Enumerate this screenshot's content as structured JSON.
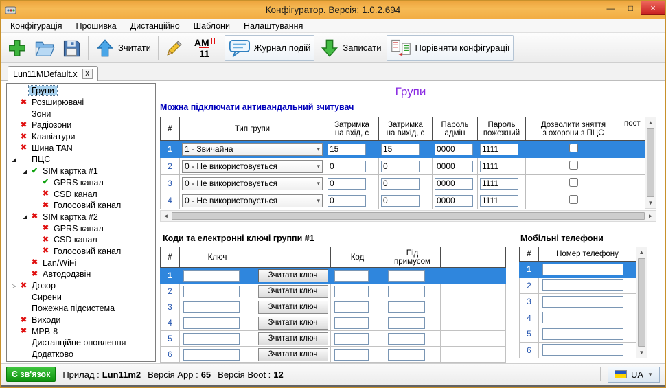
{
  "window": {
    "title": "Конфігуратор. Версія: 1.0.2.694",
    "controls": {
      "minimize": "—",
      "maximize": "□",
      "close": "×"
    }
  },
  "menu": {
    "items": [
      "Конфігурація",
      "Прошивка",
      "Дистанційно",
      "Шаблони",
      "Налаштування"
    ]
  },
  "toolbar": {
    "read_label": "Зчитати",
    "am_text": "AM",
    "am_number": "11",
    "journal_label": "Журнал подій",
    "write_label": "Записати",
    "compare_label": "Порівняти конфігурації",
    "icons": {
      "new": "green-plus",
      "open": "folder-open",
      "save": "floppy-disk",
      "read": "blue-arrow-up",
      "edit": "pencil",
      "am": "am-11-badge",
      "journal": "speech-bubble",
      "write": "green-arrow-down",
      "compare": "compare-documents"
    }
  },
  "tab": {
    "label": "Lun11MDefault.x",
    "close_label": "x"
  },
  "tree": {
    "items": [
      {
        "label": "Групи",
        "level": 0,
        "icon": "none",
        "expander": null,
        "selected": true
      },
      {
        "label": "Розширювачі",
        "level": 0,
        "icon": "cross",
        "expander": null,
        "selected": false
      },
      {
        "label": "Зони",
        "level": 0,
        "icon": "none",
        "expander": null,
        "selected": false
      },
      {
        "label": "Радіозони",
        "level": 0,
        "icon": "cross",
        "expander": null,
        "selected": false
      },
      {
        "label": "Клавіатури",
        "level": 0,
        "icon": "cross",
        "expander": null,
        "selected": false
      },
      {
        "label": "Шина TAN",
        "level": 0,
        "icon": "cross",
        "expander": null,
        "selected": false
      },
      {
        "label": "ПЦС",
        "level": 0,
        "icon": "none",
        "expander": "expanded",
        "selected": false
      },
      {
        "label": "SIM картка #1",
        "level": 1,
        "icon": "check",
        "expander": "expanded",
        "selected": false
      },
      {
        "label": "GPRS канал",
        "level": 2,
        "icon": "check",
        "expander": null,
        "selected": false
      },
      {
        "label": "CSD канал",
        "level": 2,
        "icon": "cross",
        "expander": null,
        "selected": false
      },
      {
        "label": "Голосовий канал",
        "level": 2,
        "icon": "cross",
        "expander": null,
        "selected": false
      },
      {
        "label": "SIM картка #2",
        "level": 1,
        "icon": "cross",
        "expander": "expanded",
        "selected": false
      },
      {
        "label": "GPRS канал",
        "level": 2,
        "icon": "cross",
        "expander": null,
        "selected": false
      },
      {
        "label": "CSD канал",
        "level": 2,
        "icon": "cross",
        "expander": null,
        "selected": false
      },
      {
        "label": "Голосовий канал",
        "level": 2,
        "icon": "cross",
        "expander": null,
        "selected": false
      },
      {
        "label": "Lan/WiFi",
        "level": 1,
        "icon": "cross",
        "expander": null,
        "selected": false
      },
      {
        "label": "Автододзвін",
        "level": 1,
        "icon": "cross",
        "expander": null,
        "selected": false
      },
      {
        "label": "Дозор",
        "level": 0,
        "icon": "cross",
        "expander": "collapsed",
        "selected": false
      },
      {
        "label": "Сирени",
        "level": 0,
        "icon": "none",
        "expander": null,
        "selected": false
      },
      {
        "label": "Пожежна підсистема",
        "level": 0,
        "icon": "none",
        "expander": null,
        "selected": false
      },
      {
        "label": "Виходи",
        "level": 0,
        "icon": "cross",
        "expander": null,
        "selected": false
      },
      {
        "label": "МРВ-8",
        "level": 0,
        "icon": "cross",
        "expander": null,
        "selected": false
      },
      {
        "label": "Дистанційне оновлення",
        "level": 0,
        "icon": "none",
        "expander": null,
        "selected": false
      },
      {
        "label": "Додатково",
        "level": 0,
        "icon": "none",
        "expander": null,
        "selected": false
      }
    ]
  },
  "main": {
    "title": "Групи",
    "note": "Можна підключати антивандальний зчитувач",
    "groups_table": {
      "headers": {
        "num": "#",
        "type": "Тип групи",
        "delay_in": "Затримка\nна вхід, с",
        "delay_out": "Затримка\nна вихід, с",
        "pass_admin": "Пароль\nадмін",
        "pass_fire": "Пароль\nпожежний",
        "allow": "Дозволити зняття\nз охорони з ПЦС",
        "post": "пост"
      },
      "rows": [
        {
          "num": "1",
          "type": "1 - Звичайна",
          "delay_in": "15",
          "delay_out": "15",
          "pass_admin": "0000",
          "pass_fire": "1111",
          "allow_checked": false,
          "selected": true
        },
        {
          "num": "2",
          "type": "0 - Не використовується",
          "delay_in": "0",
          "delay_out": "0",
          "pass_admin": "0000",
          "pass_fire": "1111",
          "allow_checked": false,
          "selected": false
        },
        {
          "num": "3",
          "type": "0 - Не використовується",
          "delay_in": "0",
          "delay_out": "0",
          "pass_admin": "0000",
          "pass_fire": "1111",
          "allow_checked": false,
          "selected": false
        },
        {
          "num": "4",
          "type": "0 - Не використовується",
          "delay_in": "0",
          "delay_out": "0",
          "pass_admin": "0000",
          "pass_fire": "1111",
          "allow_checked": false,
          "selected": false
        }
      ]
    },
    "keys": {
      "title": "Коди та електронні ключі группи #1",
      "headers": {
        "num": "#",
        "key": "Ключ",
        "btn": "",
        "code": "Код",
        "coercion": "Під\nпримусом",
        "filler": ""
      },
      "read_key_label": "Зчитати ключ",
      "rows": [
        {
          "num": "1",
          "key": "",
          "code": "",
          "coercion": "",
          "selected": true
        },
        {
          "num": "2",
          "key": "",
          "code": "",
          "coercion": "",
          "selected": false
        },
        {
          "num": "3",
          "key": "",
          "code": "",
          "coercion": "",
          "selected": false
        },
        {
          "num": "4",
          "key": "",
          "code": "",
          "coercion": "",
          "selected": false
        },
        {
          "num": "5",
          "key": "",
          "code": "",
          "coercion": "",
          "selected": false
        },
        {
          "num": "6",
          "key": "",
          "code": "",
          "coercion": "",
          "selected": false
        }
      ]
    },
    "phones": {
      "title": "Мобільні телефони",
      "headers": {
        "num": "#",
        "phone": "Номер телефону"
      },
      "rows": [
        {
          "num": "1",
          "phone": "",
          "selected": true
        },
        {
          "num": "2",
          "phone": "",
          "selected": false
        },
        {
          "num": "3",
          "phone": "",
          "selected": false
        },
        {
          "num": "4",
          "phone": "",
          "selected": false
        },
        {
          "num": "5",
          "phone": "",
          "selected": false
        },
        {
          "num": "6",
          "phone": "",
          "selected": false
        }
      ]
    }
  },
  "statusbar": {
    "connection": "Є зв'язок",
    "device_label": "Прилад :",
    "device_value": "Lun11m2",
    "app_label": "Версія App :",
    "app_value": "65",
    "boot_label": "Версія Boot :",
    "boot_value": "12",
    "language": "UA"
  },
  "colors": {
    "titlebar": "#f2ad43",
    "selection_blue": "#2f86dd",
    "connected_green": "#1fa31f",
    "page_title_purple": "#8a2be2",
    "note_blue": "#0000bb",
    "cross_red": "#e01010",
    "check_green": "#0ca00c",
    "ua_flag_blue": "#2257c5",
    "ua_flag_yellow": "#ffd500"
  }
}
